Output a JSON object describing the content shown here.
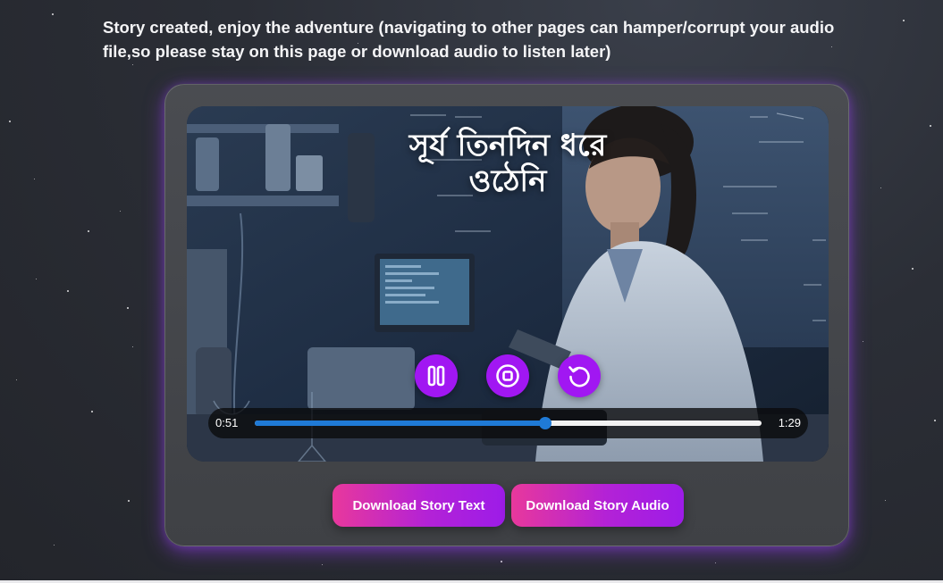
{
  "notice": "Story created, enjoy the adventure (navigating to other pages can hamper/corrupt your audio file,so please stay on this page or download audio to listen later)",
  "player": {
    "title_line1": "সূর্য তিনদিন ধরে",
    "title_line2": "ওঠেনি",
    "current_time": "0:51",
    "total_time": "1:29",
    "progress_fraction": 0.573,
    "controls": {
      "pause_icon": "pause-icon",
      "stop_icon": "stop-icon",
      "restart_icon": "restart-icon"
    }
  },
  "buttons": {
    "download_text": "Download Story Text",
    "download_audio": "Download Story Audio"
  },
  "colors": {
    "accent_purple": "#a117f2",
    "progress_blue": "#1f7ad6",
    "button_gradient_start": "#e8389c",
    "button_gradient_end": "#9d1ce8",
    "background": "#2b2e36"
  }
}
